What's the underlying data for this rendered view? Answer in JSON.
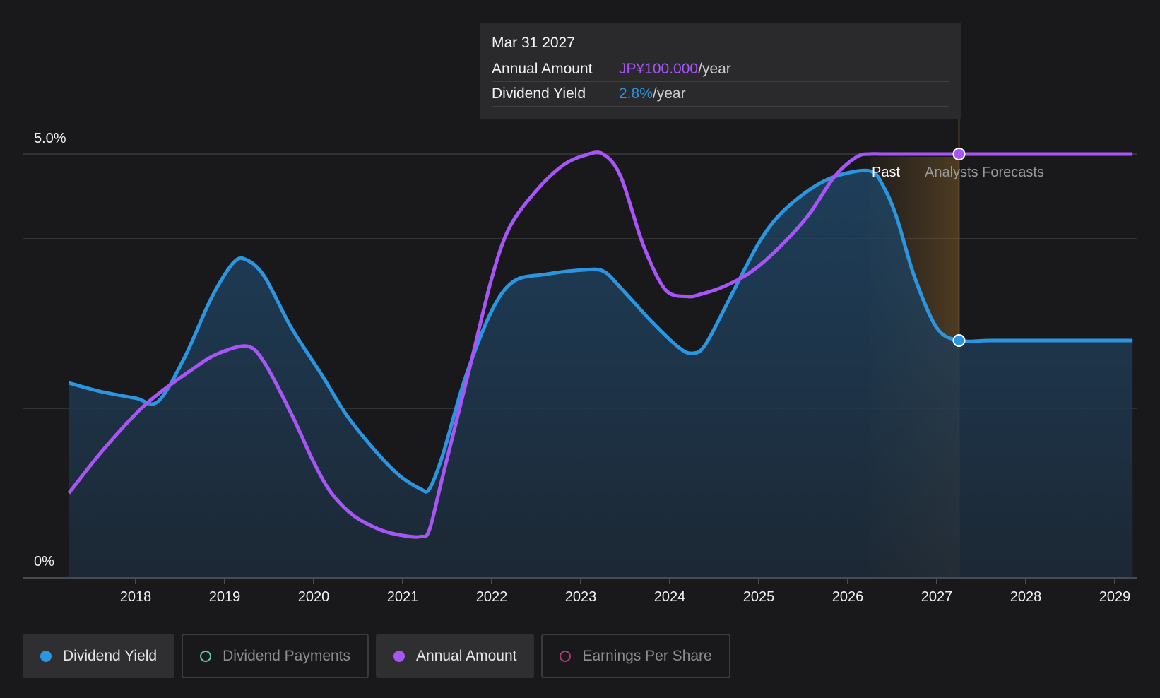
{
  "tooltip": {
    "date": "Mar 31 2027",
    "rows": [
      {
        "label": "Annual Amount",
        "value": "JP¥100.000",
        "unit": "/year"
      },
      {
        "label": "Dividend Yield",
        "value": "2.8%",
        "unit": "/year"
      }
    ]
  },
  "regions": {
    "past": "Past",
    "forecast": "Analysts Forecasts"
  },
  "legend": [
    {
      "label": "Dividend Yield",
      "state": "active",
      "icon": "filled-dot-blue"
    },
    {
      "label": "Dividend Payments",
      "state": "inactive",
      "icon": "ring-dot-teal"
    },
    {
      "label": "Annual Amount",
      "state": "active",
      "icon": "filled-dot-purple"
    },
    {
      "label": "Earnings Per Share",
      "state": "inactive",
      "icon": "ring-dot-pink"
    }
  ],
  "colors": {
    "background": "#19191b",
    "dividend_yield": "#2b95e0",
    "annual_amount": "#a855f7",
    "forecast_band": "#b07a2e",
    "grid": "#3a3a3d"
  },
  "chart_data": {
    "type": "area",
    "x_ticks": [
      "2018",
      "2019",
      "2020",
      "2021",
      "2022",
      "2023",
      "2024",
      "2025",
      "2026",
      "2027",
      "2028",
      "2029"
    ],
    "y_ticks": [
      "0%",
      "5.0%"
    ],
    "ylim": [
      0,
      5.0
    ],
    "xlim": [
      2017.0,
      2029.2
    ],
    "grid": true,
    "past_end": 2026.25,
    "forecast_marker": 2027.25,
    "series": [
      {
        "name": "Dividend Yield",
        "unit": "%",
        "filled": true,
        "x": [
          2017.25,
          2017.6,
          2018.0,
          2018.25,
          2018.55,
          2018.85,
          2019.1,
          2019.25,
          2019.45,
          2019.75,
          2020.1,
          2020.35,
          2020.65,
          2020.95,
          2021.2,
          2021.3,
          2021.45,
          2021.7,
          2022.0,
          2022.25,
          2022.6,
          2023.0,
          2023.25,
          2023.45,
          2023.8,
          2024.1,
          2024.25,
          2024.4,
          2024.7,
          2025.0,
          2025.25,
          2025.6,
          2025.9,
          2026.25,
          2026.4,
          2026.55,
          2026.75,
          2027.0,
          2027.25,
          2027.6,
          2028.0,
          2028.5,
          2029.0,
          2029.2
        ],
        "y": [
          2.3,
          2.2,
          2.12,
          2.08,
          2.6,
          3.3,
          3.72,
          3.75,
          3.55,
          2.95,
          2.38,
          1.95,
          1.55,
          1.22,
          1.05,
          1.05,
          1.45,
          2.35,
          3.15,
          3.5,
          3.58,
          3.63,
          3.62,
          3.42,
          3.02,
          2.72,
          2.65,
          2.75,
          3.35,
          3.95,
          4.3,
          4.6,
          4.75,
          4.8,
          4.62,
          4.25,
          3.55,
          2.95,
          2.8,
          2.8,
          2.8,
          2.8,
          2.8,
          2.8
        ]
      },
      {
        "name": "Annual Amount",
        "unit": "JP¥",
        "filled": false,
        "x": [
          2017.25,
          2017.6,
          2018.0,
          2018.25,
          2018.6,
          2018.9,
          2019.25,
          2019.45,
          2019.75,
          2020.0,
          2020.2,
          2020.45,
          2020.75,
          2021.0,
          2021.2,
          2021.3,
          2021.45,
          2021.75,
          2022.0,
          2022.2,
          2022.5,
          2022.8,
          2023.05,
          2023.25,
          2023.45,
          2023.7,
          2023.95,
          2024.2,
          2024.35,
          2024.6,
          2024.9,
          2025.2,
          2025.55,
          2025.85,
          2026.1,
          2026.25,
          2026.4,
          2026.7,
          2027.0,
          2027.25,
          2027.6,
          2028.0,
          2028.5,
          2029.0,
          2029.2
        ],
        "y": [
          40.0,
          47.0,
          54.0,
          57.5,
          61.5,
          64.5,
          66.0,
          63.0,
          54.0,
          45.5,
          40.0,
          36.0,
          33.5,
          32.5,
          32.3,
          33.5,
          43.0,
          62.0,
          78.0,
          87.0,
          93.5,
          98.0,
          99.8,
          100.0,
          96.0,
          84.0,
          76.0,
          74.8,
          75.2,
          76.5,
          79.0,
          83.0,
          89.0,
          96.0,
          99.5,
          100.0,
          100.0,
          100.0,
          100.0,
          100.0,
          100.0,
          100.0,
          100.0,
          100.0,
          100.0
        ],
        "ylim": [
          25,
          100
        ]
      }
    ]
  }
}
